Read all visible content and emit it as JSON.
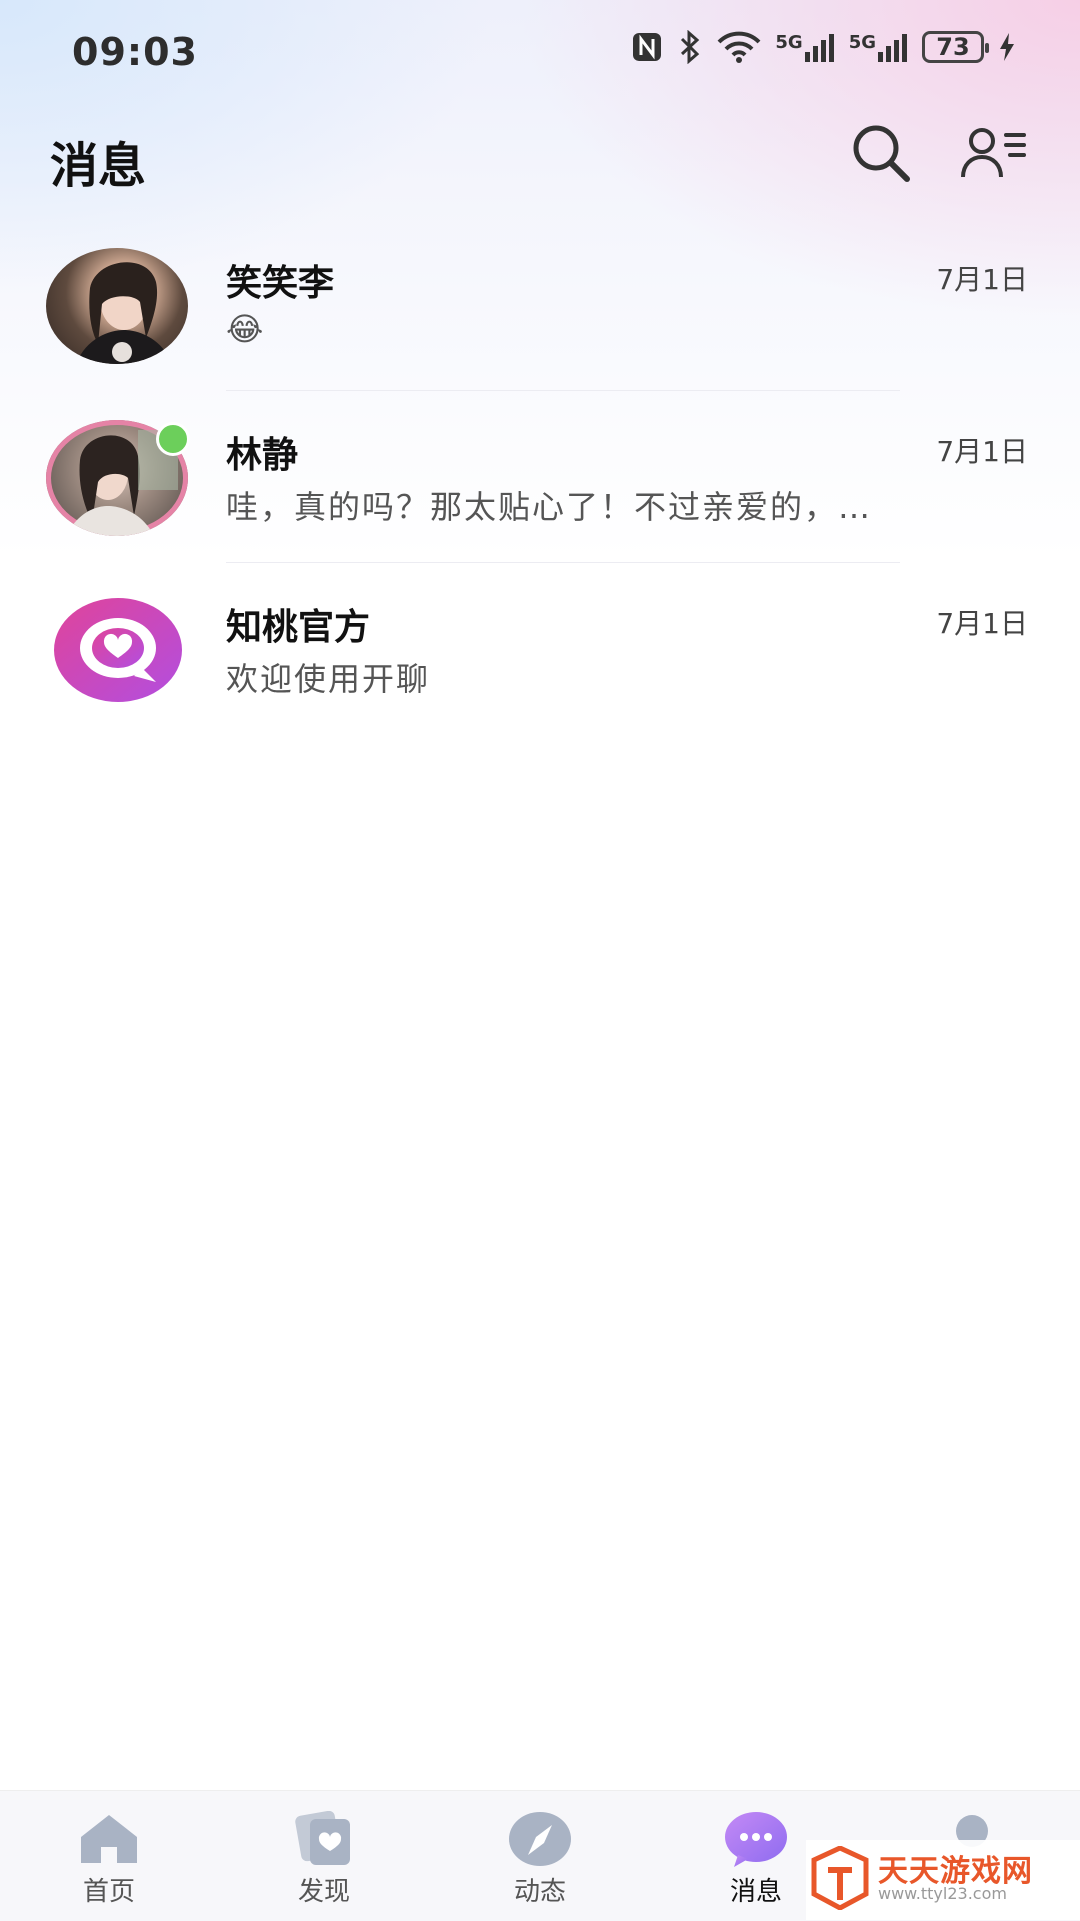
{
  "status_bar": {
    "time": "09:03",
    "network_1": "5G",
    "network_2": "5G",
    "battery": "73"
  },
  "header": {
    "title": "消息",
    "search_icon": "search-icon",
    "contacts_icon": "contacts-list-icon"
  },
  "conversations": [
    {
      "name": "笑笑李",
      "date": "7月1日",
      "preview": "😂"
    },
    {
      "name": "林静",
      "date": "7月1日",
      "preview": "哇，真的吗？那太贴心了！不过亲爱的，…"
    },
    {
      "name": "知桃官方",
      "date": "7月1日",
      "preview": "欢迎使用开聊"
    }
  ],
  "bottom_nav": [
    {
      "label": "首页",
      "icon": "home-icon"
    },
    {
      "label": "发现",
      "icon": "discover-cards-icon"
    },
    {
      "label": "动态",
      "icon": "compass-icon"
    },
    {
      "label": "消息",
      "icon": "chat-bubble-icon",
      "active": true
    },
    {
      "label": "",
      "icon": "profile-icon"
    }
  ],
  "watermark": {
    "text": "天天游戏网",
    "url": "www.ttyl23.com"
  },
  "colors": {
    "accent": "#a878f0",
    "online": "#6ccf5b",
    "official_brand": "#d23fb6"
  }
}
